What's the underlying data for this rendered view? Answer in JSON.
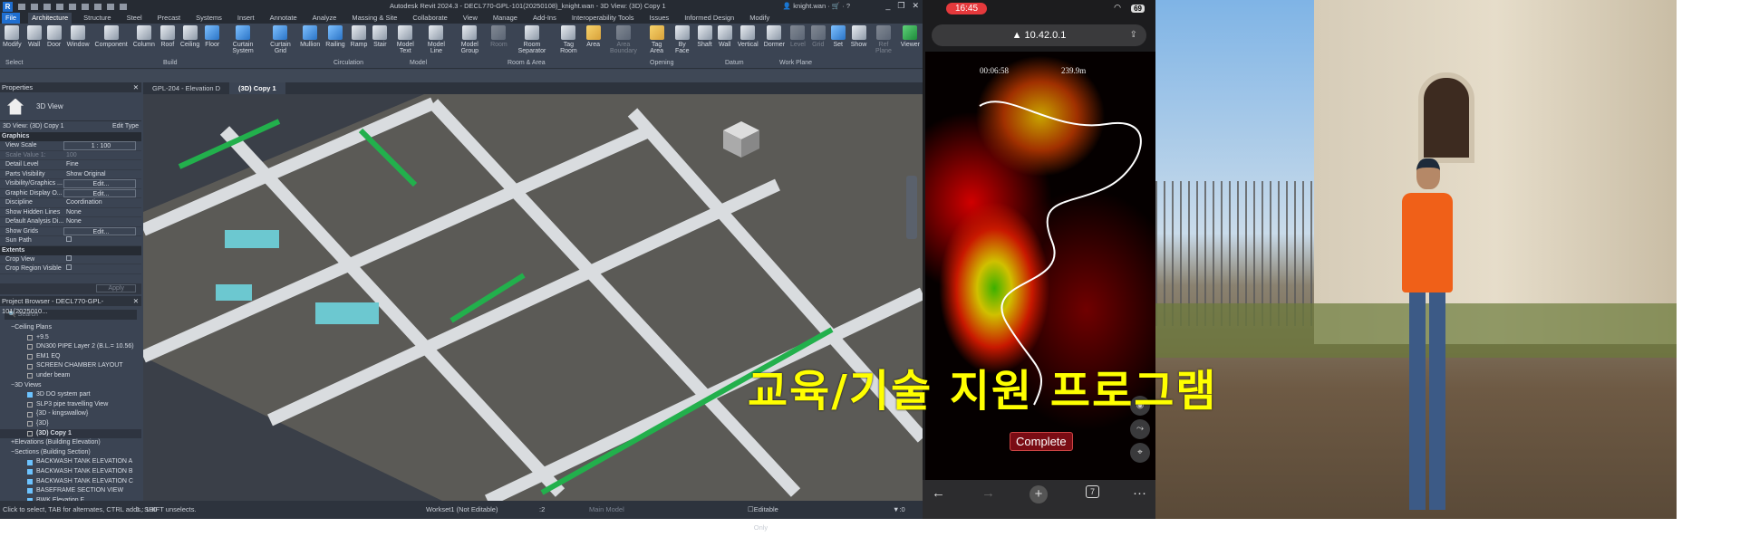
{
  "revit": {
    "title": "Autodesk Revit 2024.3 - DECL770-GPL-101(20250108)_knight.wan - 3D View: (3D) Copy 1",
    "user": "knight.wan",
    "ribbon_tabs": [
      "File",
      "Architecture",
      "Structure",
      "Steel",
      "Precast",
      "Systems",
      "Insert",
      "Annotate",
      "Analyze",
      "Massing & Site",
      "Collaborate",
      "View",
      "Manage",
      "Add-Ins",
      "Interoperability Tools",
      "Issues",
      "Informed Design",
      "Modify"
    ],
    "buttons": [
      "Modify",
      "Wall",
      "Door",
      "Window",
      "Component",
      "Column",
      "Roof",
      "Ceiling",
      "Floor",
      "Curtain System",
      "Curtain Grid",
      "Mullion",
      "Railing",
      "Ramp",
      "Stair",
      "Model Text",
      "Model Line",
      "Model Group",
      "Room",
      "Room Separator",
      "Tag Room",
      "Area",
      "Area Boundary",
      "Tag Area",
      "By Face",
      "Shaft",
      "Wall",
      "Vertical",
      "Dormer",
      "Level",
      "Grid",
      "Set",
      "Show",
      "Ref Plane",
      "Viewer"
    ],
    "groups": [
      "Select",
      "Build",
      "Circulation",
      "Model",
      "Room & Area",
      "Opening",
      "Datum",
      "Work Plane"
    ],
    "view_tabs": [
      "GPL-204 - Elevation D",
      "(3D) Copy 1"
    ],
    "properties": {
      "title": "Properties",
      "type": "3D View",
      "instance": "3D View: (3D) Copy 1",
      "edit_type": "Edit Type",
      "sections": {
        "graphics": "Graphics",
        "extents": "Extents"
      },
      "rows": [
        {
          "k": "View Scale",
          "v": "1 : 100"
        },
        {
          "k": "Scale Value    1:",
          "v": "100"
        },
        {
          "k": "Detail Level",
          "v": "Fine"
        },
        {
          "k": "Parts Visibility",
          "v": "Show Original"
        },
        {
          "k": "Visibility/Graphics ...",
          "v": "Edit..."
        },
        {
          "k": "Graphic Display O...",
          "v": "Edit..."
        },
        {
          "k": "Discipline",
          "v": "Coordination"
        },
        {
          "k": "Show Hidden Lines",
          "v": "None"
        },
        {
          "k": "Default Analysis Di...",
          "v": "None"
        },
        {
          "k": "Show Grids",
          "v": "Edit..."
        },
        {
          "k": "Sun Path",
          "v": ""
        },
        {
          "k": "Crop View",
          "v": ""
        },
        {
          "k": "Crop Region Visible",
          "v": ""
        }
      ],
      "apply": "Apply"
    },
    "browser": {
      "title": "Project Browser - DECL770-GPL-101(2025010...",
      "search": "Search",
      "items": [
        {
          "label": "Ceiling Plans",
          "lvl": 1
        },
        {
          "label": "+9.5",
          "lvl": 2
        },
        {
          "label": "DN300 PIPE Layer 2 (B.L.= 10.56)",
          "lvl": 2
        },
        {
          "label": "EM1 EQ",
          "lvl": 2
        },
        {
          "label": "SCREEN CHAMBER LAYOUT",
          "lvl": 2
        },
        {
          "label": "under beam",
          "lvl": 2
        },
        {
          "label": "3D Views",
          "lvl": 1
        },
        {
          "label": "3D DO system part",
          "lvl": 2,
          "f": true
        },
        {
          "label": "SLP3 pipe travelling View",
          "lvl": 2
        },
        {
          "label": "{3D - kingswallow}",
          "lvl": 2
        },
        {
          "label": "{3D}",
          "lvl": 2
        },
        {
          "label": "(3D) Copy 1",
          "lvl": 2,
          "sel": true
        },
        {
          "label": "Elevations (Building Elevation)",
          "lvl": 1
        },
        {
          "label": "Sections (Building Section)",
          "lvl": 1
        },
        {
          "label": "BACKWASH TANK ELEVATION A",
          "lvl": 2,
          "f": true
        },
        {
          "label": "BACKWASH TANK ELEVATION B",
          "lvl": 2,
          "f": true
        },
        {
          "label": "BACKWASH TANK ELEVATION C",
          "lvl": 2,
          "f": true
        },
        {
          "label": "BASEFRAME SECTION VIEW",
          "lvl": 2,
          "f": true
        },
        {
          "label": "BWK Elevation F",
          "lvl": 2,
          "f": true
        }
      ]
    },
    "status": {
      "hint": "Click to select, TAB for alternates, CTRL adds, SHIFT unselects.",
      "workset": "Workset1 (Not Editable)",
      "count": ":2",
      "model": "Main Model",
      "editable_only": "Editable Only",
      "filter": ":0",
      "scale": "1 : 100"
    }
  },
  "phone": {
    "time": "16:45",
    "battery": "69",
    "url": "10.42.0.1",
    "timer": "00:06:58",
    "distance": "239.9m",
    "complete": "Complete",
    "tabs": "7"
  },
  "caption": "교육/기술 지원 프로그램"
}
